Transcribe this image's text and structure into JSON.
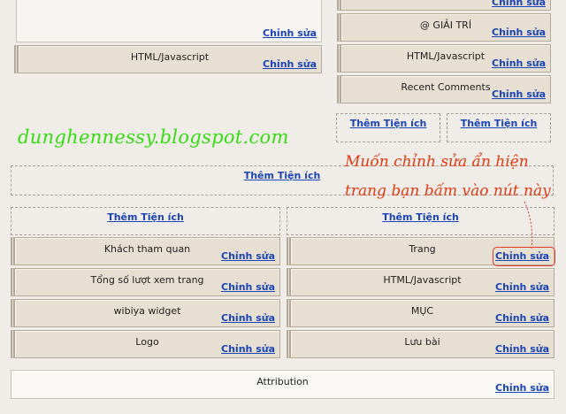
{
  "edit_label": "Chỉnh sửa",
  "add_widget_label": "Thêm Tiện ích",
  "top_left_panel": {
    "edit": "Chỉnh sửa"
  },
  "left_html_widget": {
    "title": "HTML/Javascript",
    "edit": "Chỉnh sửa"
  },
  "right_sidebar": {
    "top_partial": {
      "edit": "Chỉnh sửa"
    },
    "widgets": [
      {
        "title": "@ GIẢI TRÍ",
        "edit": "Chỉnh sửa"
      },
      {
        "title": "HTML/Javascript",
        "edit": "Chỉnh sửa"
      },
      {
        "title": "Recent Comments",
        "edit": "Chỉnh sửa"
      }
    ],
    "add_left": "Thêm Tiện ích",
    "add_right": "Thêm Tiện ích"
  },
  "watermark": "dunghennessy.blogspot.com",
  "annotation": {
    "line1": "Muốn chỉnh sửa ẩn hiện",
    "line2": "trang bạn bấm vào nút này"
  },
  "wide_add": "Thêm Tiện ích",
  "footer_left": {
    "add": "Thêm Tiện ích",
    "widgets": [
      {
        "title": "Khách tham quan",
        "edit": "Chỉnh sửa"
      },
      {
        "title": "Tổng số lượt xem trang",
        "edit": "Chỉnh sửa"
      },
      {
        "title": "wibiya widget",
        "edit": "Chỉnh sửa"
      },
      {
        "title": "Logo",
        "edit": "Chỉnh sửa"
      }
    ]
  },
  "footer_right": {
    "add": "Thêm Tiện ích",
    "widgets": [
      {
        "title": "Trang",
        "edit": "Chỉnh sửa"
      },
      {
        "title": "HTML/Javascript",
        "edit": "Chỉnh sửa"
      },
      {
        "title": "MỤC",
        "edit": "Chỉnh sửa"
      },
      {
        "title": "Lưu bài",
        "edit": "Chỉnh sửa"
      }
    ]
  },
  "attribution": {
    "title": "Attribution",
    "edit": "Chỉnh sửa"
  },
  "colors": {
    "background": "#f0ede8",
    "widget_bg": "#e6dfd2",
    "link": "#1a44b8",
    "watermark": "#33dd11",
    "annotation": "#e23a10"
  }
}
